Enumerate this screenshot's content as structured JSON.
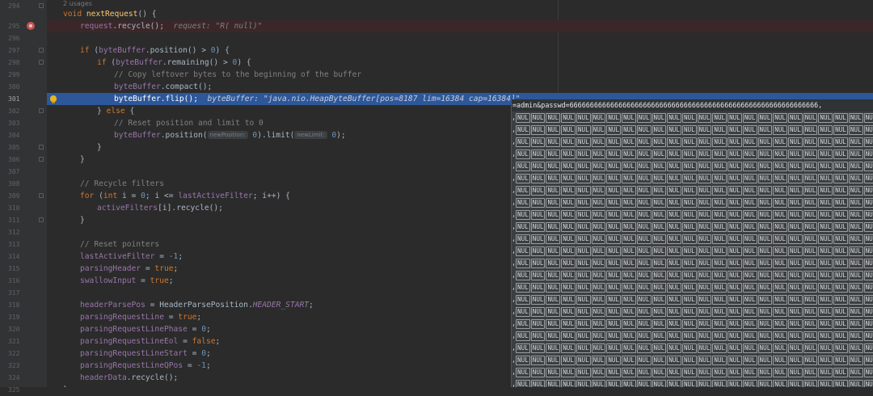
{
  "colors": {
    "background": "#2b2b2b",
    "gutter": "#313335",
    "current_line": "#2d5799",
    "breakpoint_line": "#3b2729",
    "keyword": "#cc7832",
    "function": "#ffc66d",
    "number": "#6897bb",
    "comment": "#808080",
    "field": "#9876aa",
    "popup": "#3c3f41"
  },
  "editor": {
    "usage_hint": "2 usages",
    "gutter": {
      "line_numbers": [
        "294",
        "295",
        "296",
        "297",
        "298",
        "299",
        "300",
        "301",
        "302",
        "303",
        "304",
        "305",
        "306",
        "307",
        "308",
        "309",
        "310",
        "311",
        "312",
        "313",
        "314",
        "315",
        "316",
        "317",
        "318",
        "319",
        "320",
        "321",
        "322",
        "323",
        "324",
        "325"
      ],
      "breakpoint_line": "295",
      "current_line": "301",
      "icons": [
        "breakpoint-icon",
        "fold-icon",
        "intention-bulb-icon"
      ]
    },
    "code": {
      "l294": {
        "kw": "void",
        "fn": "nextRequest",
        "rest": "() {"
      },
      "l295": {
        "obj": "request",
        "rest": ".recycle();",
        "inline": "request: \"R( null)\""
      },
      "l297": {
        "kw": "if",
        "a": " (",
        "fld": "byteBuffer",
        "b": ".position() > ",
        "num": "0",
        "c": ") {"
      },
      "l298": {
        "kw": "if",
        "a": " (",
        "fld": "byteBuffer",
        "b": ".remaining() > ",
        "num": "0",
        "c": ") {"
      },
      "l299": {
        "comment": "// Copy leftover bytes to the beginning of the buffer"
      },
      "l300": {
        "fld": "byteBuffer",
        "rest": ".compact();"
      },
      "l301": {
        "fld": "byteBuffer",
        "rest": ".flip();",
        "inline": "byteBuffer: \"java.nio.HeapByteBuffer[pos=8187 lim=16384 cap=16384]\""
      },
      "l302": {
        "a": "} ",
        "kw": "else",
        "b": " {"
      },
      "l303": {
        "comment": "// Reset position and limit to 0"
      },
      "l304": {
        "fld": "byteBuffer",
        "a": ".position(",
        "hint1": "newPosition:",
        "num1": "0",
        "b": ").limit(",
        "hint2": "newLimit:",
        "num2": "0",
        "c": ");"
      },
      "l305": {
        "text": "}"
      },
      "l306": {
        "text": "}"
      },
      "l308": {
        "comment": "// Recycle filters"
      },
      "l309": {
        "kw1": "for",
        "a": " (",
        "kw2": "int",
        "b": " i = ",
        "num": "0",
        "c": "; i <= ",
        "fld": "lastActiveFilter",
        "d": "; i++) {"
      },
      "l310": {
        "fld": "activeFilters",
        "rest": "[i].recycle();"
      },
      "l311": {
        "text": "}"
      },
      "l313": {
        "comment": "// Reset pointers"
      },
      "l314": {
        "fld": "lastActiveFilter",
        "a": " = ",
        "num": "-1",
        "b": ";"
      },
      "l315": {
        "fld": "parsingHeader",
        "a": " = ",
        "kw": "true",
        "b": ";"
      },
      "l316": {
        "fld": "swallowInput",
        "a": " = ",
        "kw": "true",
        "b": ";"
      },
      "l318": {
        "fld": "headerParsePos",
        "a": " = HeaderParsePosition.",
        "const": "HEADER_START",
        "b": ";"
      },
      "l319": {
        "fld": "parsingRequestLine",
        "a": " = ",
        "kw": "true",
        "b": ";"
      },
      "l320": {
        "fld": "parsingRequestLinePhase",
        "a": " = ",
        "num": "0",
        "b": ";"
      },
      "l321": {
        "fld": "parsingRequestLineEol",
        "a": " = ",
        "kw": "false",
        "b": ";"
      },
      "l322": {
        "fld": "parsingRequestLineStart",
        "a": " = ",
        "num": "0",
        "b": ";"
      },
      "l323": {
        "fld": "parsingRequestLineQPos",
        "a": " = ",
        "num": "-1",
        "b": ";"
      },
      "l324": {
        "fld": "headerData",
        "rest": ".recycle();"
      },
      "l325": {
        "text": "}"
      }
    }
  },
  "popup": {
    "header_text": "=admin&passwd=6666666666666666666666666666666666666666666666666666666666666",
    "header_suffix": ",",
    "row_prefix": ",",
    "nul_token": "NUL",
    "row_count": 24
  }
}
